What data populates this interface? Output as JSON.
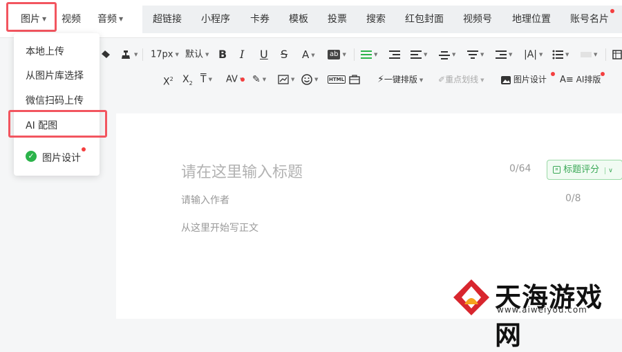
{
  "top_tabs": {
    "image": "图片",
    "video": "视频",
    "audio": "音频",
    "hyperlink": "超链接",
    "mini_program": "小程序",
    "coupon": "卡券",
    "template": "模板",
    "vote": "投票",
    "search": "搜索",
    "red_packet_cover": "红包封面",
    "channels": "视频号",
    "location": "地理位置",
    "account_card": "账号名片"
  },
  "toolbar": {
    "font_size": "17px",
    "font_family": "默认",
    "one_click_layout": "一键排版",
    "highlight": "重点划线",
    "image_design": "图片设计",
    "ai_layout": "AI排版"
  },
  "image_menu": {
    "items": [
      "本地上传",
      "从图片库选择",
      "微信扫码上传",
      "AI 配图"
    ],
    "image_design": "图片设计"
  },
  "editor": {
    "title_placeholder": "请在这里输入标题",
    "title_counter": "0/64",
    "title_score": "标题评分",
    "author_placeholder": "请输入作者",
    "author_counter": "0/8",
    "body_placeholder": "从这里开始写正文"
  },
  "watermark": {
    "text": "天海游戏网",
    "url": "www.aiweiyou.com"
  },
  "colors": {
    "accent_red": "#f2555f",
    "notify_dot": "#f43f3f",
    "green": "#3aa856",
    "logo_red": "#d8262e"
  }
}
